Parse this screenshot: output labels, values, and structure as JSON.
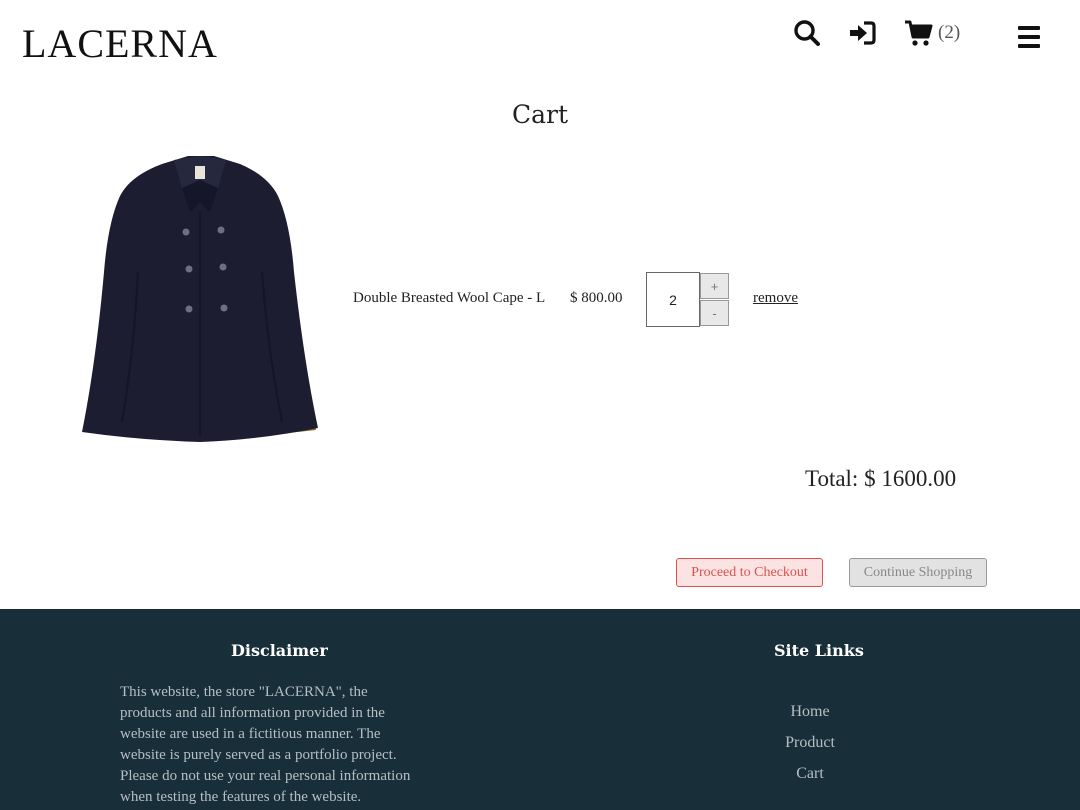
{
  "header": {
    "logo": "LACERNA",
    "cart_count": "(2)",
    "icons": [
      "search-icon",
      "sign-in-icon",
      "cart-icon",
      "menu-icon"
    ]
  },
  "page": {
    "title": "Cart"
  },
  "cart": {
    "items": [
      {
        "name": "Double Breasted Wool Cape - L",
        "price": "$ 800.00",
        "quantity": "2",
        "plus_label": "+",
        "minus_label": "-",
        "remove_label": "remove"
      }
    ],
    "total": "Total: $ 1600.00",
    "checkout_label": "Proceed to Checkout",
    "continue_label": "Continue Shopping"
  },
  "footer": {
    "disclaimer_title": "Disclaimer",
    "disclaimer_text": "This website, the store \"LACERNA\", the products and all information provided in the website are used in a fictitious manner. The website is purely served as a portfolio project. Please do not use your real personal information when testing the features of the website.",
    "links_title": "Site Links",
    "links": [
      "Home",
      "Product",
      "Cart"
    ]
  },
  "colors": {
    "footer_bg": "#182f3a",
    "checkout_accent": "#d9534f"
  }
}
